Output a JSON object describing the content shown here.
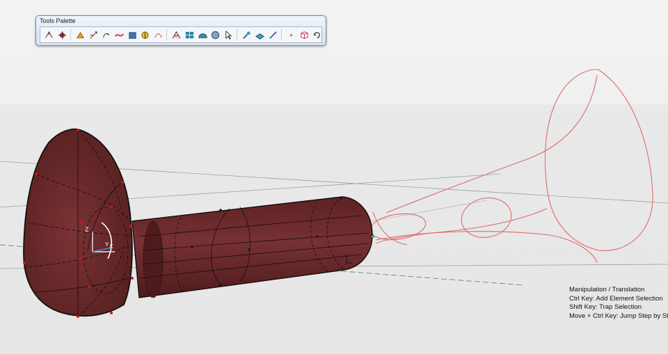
{
  "palette": {
    "title": "Tools Palette",
    "tools": [
      {
        "name": "compass-icon"
      },
      {
        "name": "snap-point-icon"
      },
      {
        "name": "separator"
      },
      {
        "name": "manipulate-icon"
      },
      {
        "name": "translation-icon"
      },
      {
        "name": "rotation-icon"
      },
      {
        "name": "deform-icon"
      },
      {
        "name": "shape-icon"
      },
      {
        "name": "analysis-icon"
      },
      {
        "name": "curvature-icon"
      },
      {
        "name": "separator"
      },
      {
        "name": "continuity-icon"
      },
      {
        "name": "mesh-icon"
      },
      {
        "name": "dome-icon"
      },
      {
        "name": "sphere-icon"
      },
      {
        "name": "pointer-icon"
      },
      {
        "name": "separator"
      },
      {
        "name": "brush-icon"
      },
      {
        "name": "layer-icon"
      },
      {
        "name": "line-icon"
      },
      {
        "name": "separator"
      },
      {
        "name": "point-icon"
      },
      {
        "name": "box-icon"
      },
      {
        "name": "refresh-icon"
      }
    ]
  },
  "axes": {
    "z_label": "Z",
    "y_label": "Y",
    "x_label": "X"
  },
  "hints": {
    "line1": " Manipulation / Translation",
    "line2": "Ctrl Key: Add Element Selection",
    "line3": "Shift Key: Trap Selection",
    "line4": "Move + Ctrl Key: Jump Step by Step"
  },
  "colors": {
    "solid": "#6b2a2c",
    "solid_edge": "#1a0a0a",
    "wire": "#e06a6a",
    "palette_border": "#6f8aa8"
  }
}
